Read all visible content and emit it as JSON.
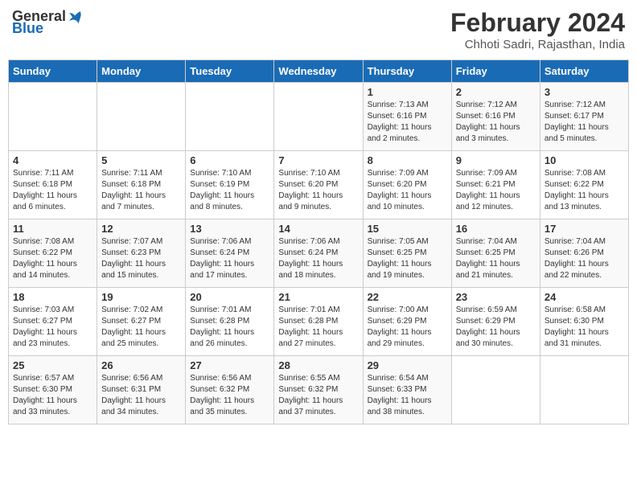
{
  "header": {
    "logo_general": "General",
    "logo_blue": "Blue",
    "title": "February 2024",
    "subtitle": "Chhoti Sadri, Rajasthan, India"
  },
  "days_of_week": [
    "Sunday",
    "Monday",
    "Tuesday",
    "Wednesday",
    "Thursday",
    "Friday",
    "Saturday"
  ],
  "weeks": [
    [
      {
        "day": "",
        "info": ""
      },
      {
        "day": "",
        "info": ""
      },
      {
        "day": "",
        "info": ""
      },
      {
        "day": "",
        "info": ""
      },
      {
        "day": "1",
        "info": "Sunrise: 7:13 AM\nSunset: 6:16 PM\nDaylight: 11 hours and 2 minutes."
      },
      {
        "day": "2",
        "info": "Sunrise: 7:12 AM\nSunset: 6:16 PM\nDaylight: 11 hours and 3 minutes."
      },
      {
        "day": "3",
        "info": "Sunrise: 7:12 AM\nSunset: 6:17 PM\nDaylight: 11 hours and 5 minutes."
      }
    ],
    [
      {
        "day": "4",
        "info": "Sunrise: 7:11 AM\nSunset: 6:18 PM\nDaylight: 11 hours and 6 minutes."
      },
      {
        "day": "5",
        "info": "Sunrise: 7:11 AM\nSunset: 6:18 PM\nDaylight: 11 hours and 7 minutes."
      },
      {
        "day": "6",
        "info": "Sunrise: 7:10 AM\nSunset: 6:19 PM\nDaylight: 11 hours and 8 minutes."
      },
      {
        "day": "7",
        "info": "Sunrise: 7:10 AM\nSunset: 6:20 PM\nDaylight: 11 hours and 9 minutes."
      },
      {
        "day": "8",
        "info": "Sunrise: 7:09 AM\nSunset: 6:20 PM\nDaylight: 11 hours and 10 minutes."
      },
      {
        "day": "9",
        "info": "Sunrise: 7:09 AM\nSunset: 6:21 PM\nDaylight: 11 hours and 12 minutes."
      },
      {
        "day": "10",
        "info": "Sunrise: 7:08 AM\nSunset: 6:22 PM\nDaylight: 11 hours and 13 minutes."
      }
    ],
    [
      {
        "day": "11",
        "info": "Sunrise: 7:08 AM\nSunset: 6:22 PM\nDaylight: 11 hours and 14 minutes."
      },
      {
        "day": "12",
        "info": "Sunrise: 7:07 AM\nSunset: 6:23 PM\nDaylight: 11 hours and 15 minutes."
      },
      {
        "day": "13",
        "info": "Sunrise: 7:06 AM\nSunset: 6:24 PM\nDaylight: 11 hours and 17 minutes."
      },
      {
        "day": "14",
        "info": "Sunrise: 7:06 AM\nSunset: 6:24 PM\nDaylight: 11 hours and 18 minutes."
      },
      {
        "day": "15",
        "info": "Sunrise: 7:05 AM\nSunset: 6:25 PM\nDaylight: 11 hours and 19 minutes."
      },
      {
        "day": "16",
        "info": "Sunrise: 7:04 AM\nSunset: 6:25 PM\nDaylight: 11 hours and 21 minutes."
      },
      {
        "day": "17",
        "info": "Sunrise: 7:04 AM\nSunset: 6:26 PM\nDaylight: 11 hours and 22 minutes."
      }
    ],
    [
      {
        "day": "18",
        "info": "Sunrise: 7:03 AM\nSunset: 6:27 PM\nDaylight: 11 hours and 23 minutes."
      },
      {
        "day": "19",
        "info": "Sunrise: 7:02 AM\nSunset: 6:27 PM\nDaylight: 11 hours and 25 minutes."
      },
      {
        "day": "20",
        "info": "Sunrise: 7:01 AM\nSunset: 6:28 PM\nDaylight: 11 hours and 26 minutes."
      },
      {
        "day": "21",
        "info": "Sunrise: 7:01 AM\nSunset: 6:28 PM\nDaylight: 11 hours and 27 minutes."
      },
      {
        "day": "22",
        "info": "Sunrise: 7:00 AM\nSunset: 6:29 PM\nDaylight: 11 hours and 29 minutes."
      },
      {
        "day": "23",
        "info": "Sunrise: 6:59 AM\nSunset: 6:29 PM\nDaylight: 11 hours and 30 minutes."
      },
      {
        "day": "24",
        "info": "Sunrise: 6:58 AM\nSunset: 6:30 PM\nDaylight: 11 hours and 31 minutes."
      }
    ],
    [
      {
        "day": "25",
        "info": "Sunrise: 6:57 AM\nSunset: 6:30 PM\nDaylight: 11 hours and 33 minutes."
      },
      {
        "day": "26",
        "info": "Sunrise: 6:56 AM\nSunset: 6:31 PM\nDaylight: 11 hours and 34 minutes."
      },
      {
        "day": "27",
        "info": "Sunrise: 6:56 AM\nSunset: 6:32 PM\nDaylight: 11 hours and 35 minutes."
      },
      {
        "day": "28",
        "info": "Sunrise: 6:55 AM\nSunset: 6:32 PM\nDaylight: 11 hours and 37 minutes."
      },
      {
        "day": "29",
        "info": "Sunrise: 6:54 AM\nSunset: 6:33 PM\nDaylight: 11 hours and 38 minutes."
      },
      {
        "day": "",
        "info": ""
      },
      {
        "day": "",
        "info": ""
      }
    ]
  ]
}
